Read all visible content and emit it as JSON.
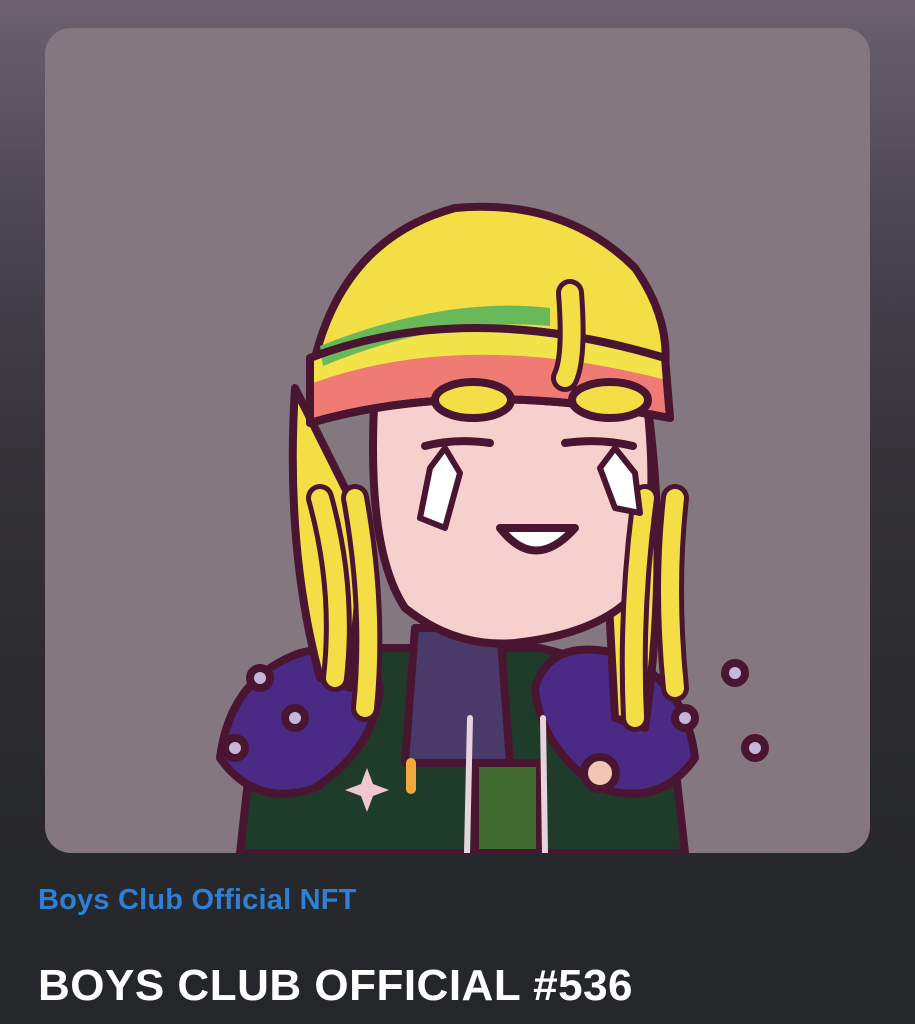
{
  "nft": {
    "collection_name": "Boys Club Official NFT",
    "title": "BOYS CLUB OFFICIAL #536",
    "image_alt": "BOYS CLUB OFFICIAL #536"
  },
  "colors": {
    "page_bg_top": "#6b6170",
    "page_bg_bottom": "#24262a",
    "artwork_bg": "#85777f",
    "collection_link": "#2f7fd4",
    "title_text": "#ffffff"
  }
}
